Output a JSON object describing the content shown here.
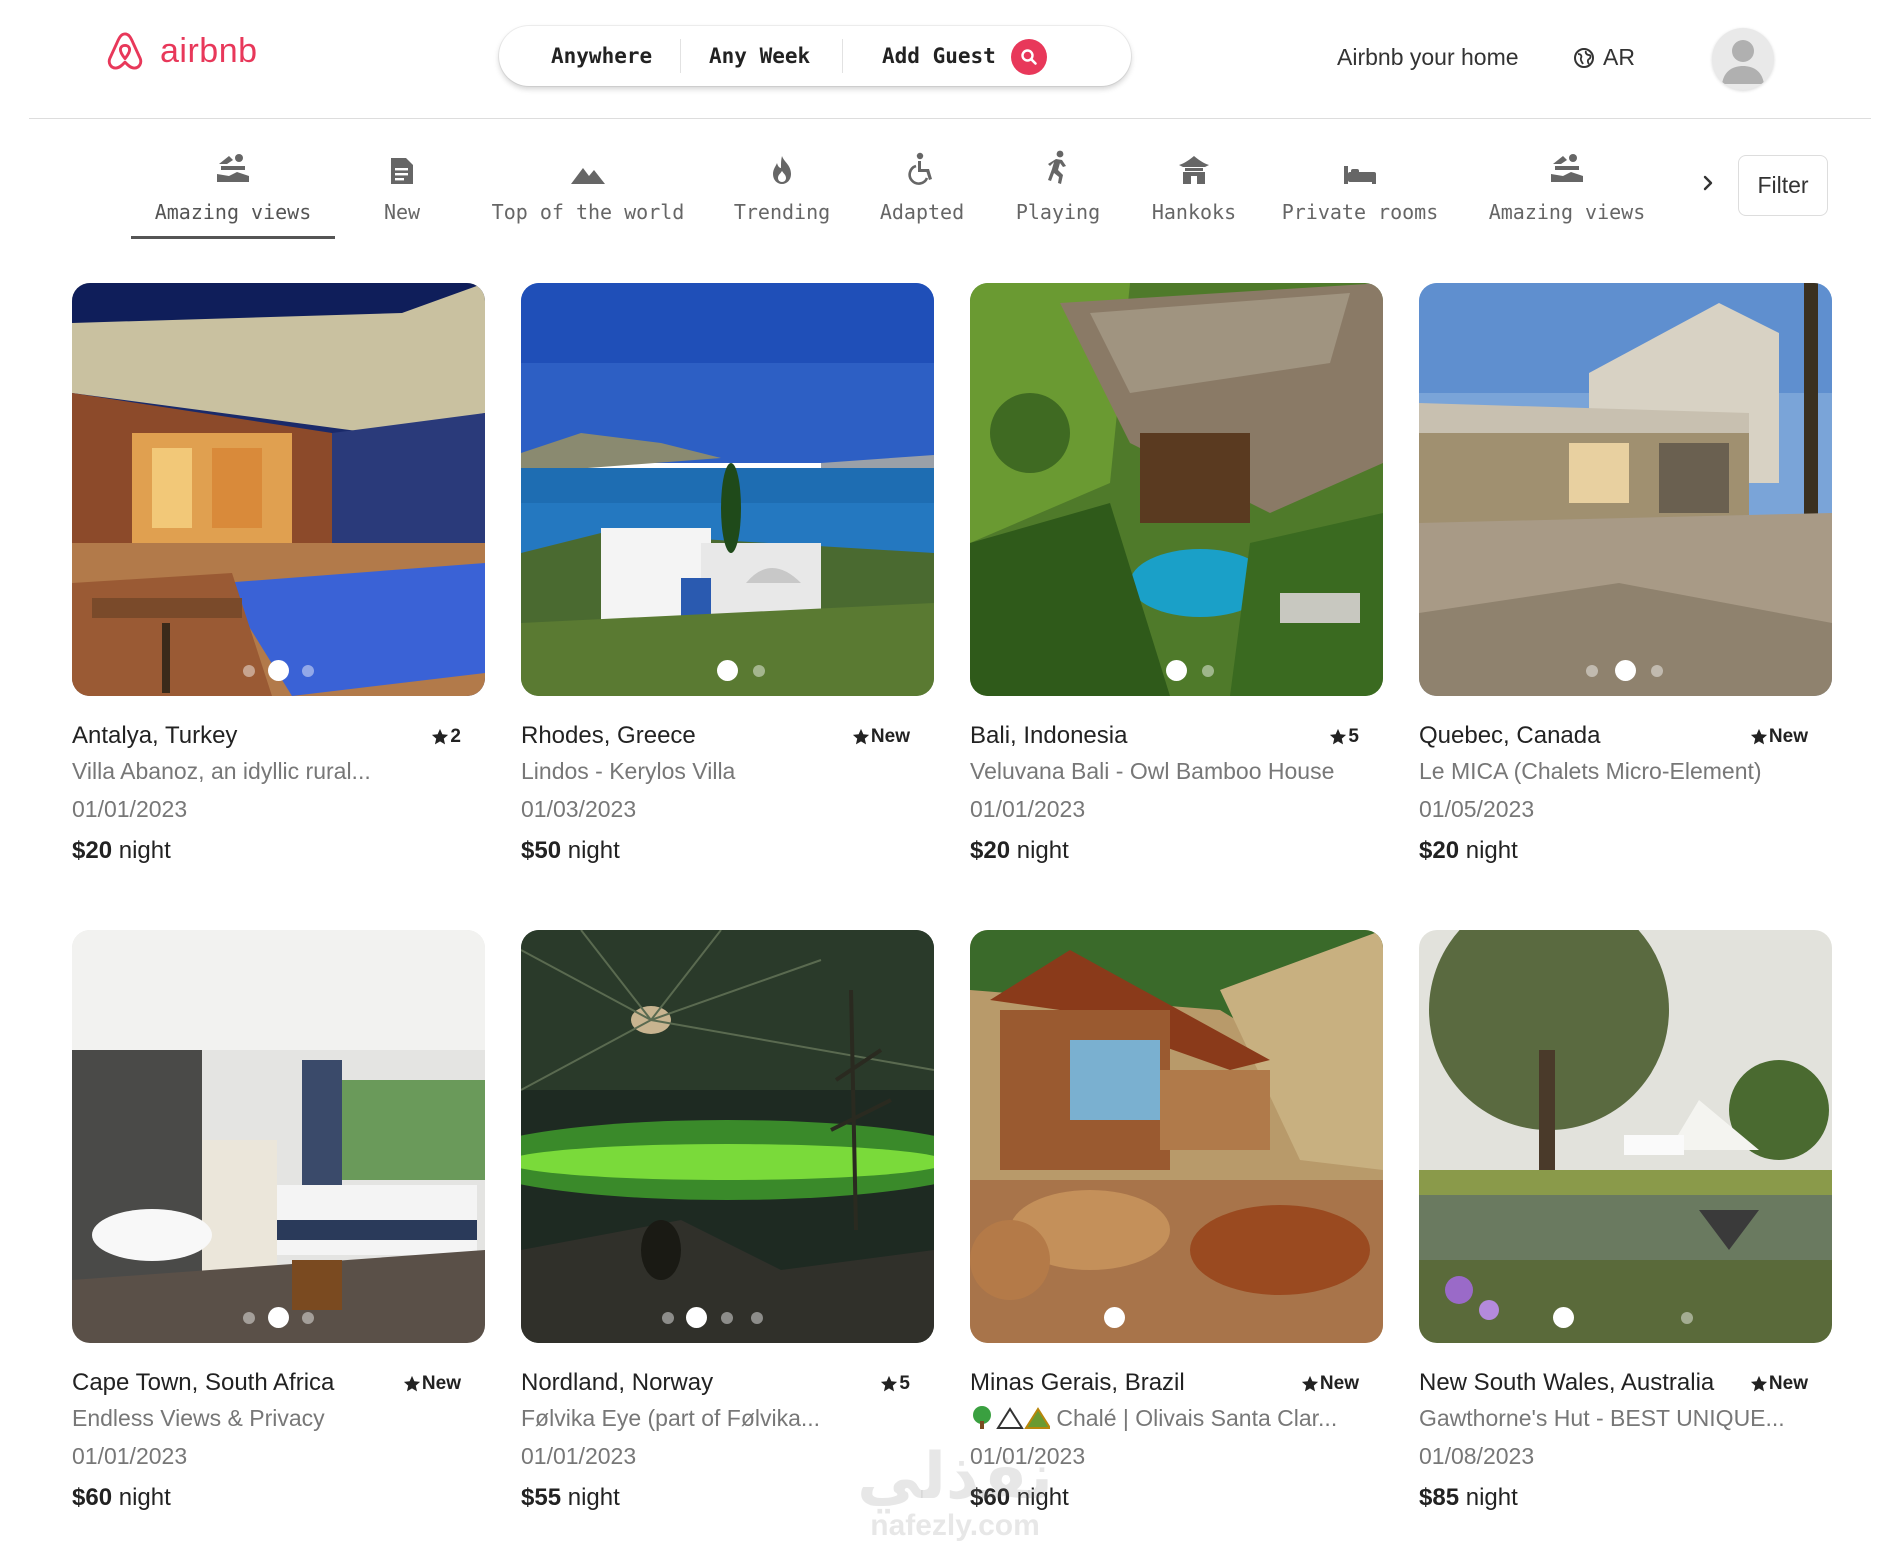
{
  "header": {
    "logo_text": "airbnb",
    "search": {
      "where": "Anywhere",
      "when": "Any Week",
      "who": "Add Guest"
    },
    "host_link": "Airbnb your home",
    "language": "AR"
  },
  "categories": [
    {
      "label": "Amazing views",
      "icon": "amazing-views-icon",
      "active": true
    },
    {
      "label": "New",
      "icon": "document-icon",
      "active": false
    },
    {
      "label": "Top of the world",
      "icon": "mountain-icon",
      "active": false
    },
    {
      "label": "Trending",
      "icon": "fire-icon",
      "active": false
    },
    {
      "label": "Adapted",
      "icon": "wheelchair-icon",
      "active": false
    },
    {
      "label": "Playing",
      "icon": "running-person-icon",
      "active": false
    },
    {
      "label": "Hankoks",
      "icon": "hanok-house-icon",
      "active": false
    },
    {
      "label": "Private rooms",
      "icon": "bed-icon",
      "active": false
    },
    {
      "label": "Amazing views",
      "icon": "amazing-views-icon",
      "active": false
    }
  ],
  "filter_label": "Filter",
  "listings": [
    {
      "location": "Antalya, Turkey",
      "rating": "2",
      "title": "Villa Abanoz, an idyllic rural...",
      "date": "01/01/2023",
      "price": "$20",
      "unit": "night"
    },
    {
      "location": "Rhodes, Greece",
      "rating": "New",
      "title": "Lindos - Kerylos Villa",
      "date": "01/03/2023",
      "price": "$50",
      "unit": "night"
    },
    {
      "location": "Bali, Indonesia",
      "rating": "5",
      "title": "Veluvana Bali - Owl Bamboo House",
      "date": "01/01/2023",
      "price": "$20",
      "unit": "night"
    },
    {
      "location": "Quebec, Canada",
      "rating": "New",
      "title": "Le MICA (Chalets Micro-Element)",
      "date": "01/05/2023",
      "price": "$20",
      "unit": "night"
    },
    {
      "location": "Cape Town, South Africa",
      "rating": "New",
      "title": "Endless Views & Privacy",
      "date": "01/01/2023",
      "price": "$60",
      "unit": "night"
    },
    {
      "location": "Nordland, Norway",
      "rating": "5",
      "title": "Følvika Eye (part of Følvika...",
      "date": "01/01/2023",
      "price": "$55",
      "unit": "night"
    },
    {
      "location": "Minas Gerais, Brazil",
      "rating": "New",
      "title": "Chalé | Olivais Santa Clar...",
      "date": "01/01/2023",
      "price": "$60",
      "unit": "night"
    },
    {
      "location": "New South Wales, Australia",
      "rating": "New",
      "title": "Gawthorne's Hut - BEST UNIQUE...",
      "date": "01/08/2023",
      "price": "$85",
      "unit": "night"
    }
  ],
  "watermark": {
    "arabic": "نفذلي",
    "latin": "nafezly.com"
  },
  "colors": {
    "brand": "#e8385a",
    "text": "#222222",
    "muted": "#777777"
  }
}
